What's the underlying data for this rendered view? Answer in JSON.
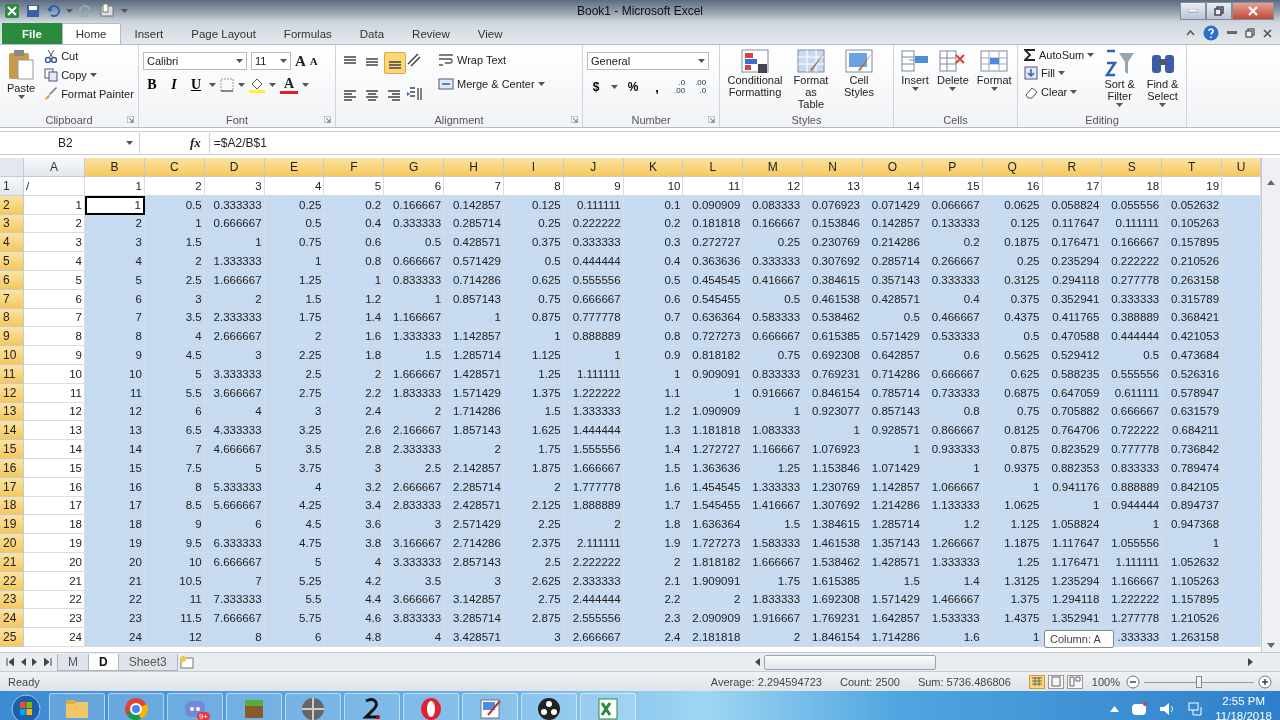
{
  "window": {
    "title": "Book1 - Microsoft Excel"
  },
  "ribbon_tabs": [
    {
      "label": "File",
      "kind": "file",
      "selected": false
    },
    {
      "label": "Home",
      "kind": "tab",
      "selected": true
    },
    {
      "label": "Insert",
      "kind": "tab",
      "selected": false
    },
    {
      "label": "Page Layout",
      "kind": "tab",
      "selected": false
    },
    {
      "label": "Formulas",
      "kind": "tab",
      "selected": false
    },
    {
      "label": "Data",
      "kind": "tab",
      "selected": false
    },
    {
      "label": "Review",
      "kind": "tab",
      "selected": false
    },
    {
      "label": "View",
      "kind": "tab",
      "selected": false
    }
  ],
  "clipboard": {
    "label": "Clipboard",
    "paste": "Paste",
    "cut": "Cut",
    "copy": "Copy",
    "format_painter": "Format Painter"
  },
  "font": {
    "label": "Font",
    "family": "Calibri",
    "size": "11",
    "grow": "A",
    "shrink": "A",
    "bold": "B",
    "italic": "I",
    "underline": "U",
    "font_color": "A"
  },
  "alignment": {
    "label": "Alignment",
    "wrap_text": "Wrap Text",
    "merge_center": "Merge & Center",
    "bottom_align_on": true
  },
  "number": {
    "label": "Number",
    "format": "General",
    "currency": "$",
    "percent": "%",
    "comma": ",",
    "increase_decimal": [
      ".0",
      ".00"
    ],
    "decrease_decimal": [
      ".00",
      ".0"
    ]
  },
  "styles": {
    "label": "Styles",
    "buttons": [
      "Conditional Formatting",
      "Format as Table",
      "Cell Styles"
    ]
  },
  "cells": {
    "label": "Cells",
    "buttons": [
      "Insert",
      "Delete",
      "Format"
    ]
  },
  "editing": {
    "label": "Editing",
    "autosum": "AutoSum",
    "fill": "Fill",
    "clear": "Clear",
    "sort_filter": "Sort & Filter",
    "find_select": "Find & Select"
  },
  "formula_bar": {
    "name_box": "B2",
    "fx": "fx",
    "formula": "=$A2/B$1"
  },
  "columns": [
    {
      "label": "A",
      "selected": false
    },
    {
      "label": "B",
      "selected": true
    },
    {
      "label": "C",
      "selected": true
    },
    {
      "label": "D",
      "selected": true
    },
    {
      "label": "E",
      "selected": true
    },
    {
      "label": "F",
      "selected": true
    },
    {
      "label": "G",
      "selected": true
    },
    {
      "label": "H",
      "selected": true
    },
    {
      "label": "I",
      "selected": true
    },
    {
      "label": "J",
      "selected": true
    },
    {
      "label": "K",
      "selected": true
    },
    {
      "label": "L",
      "selected": true
    },
    {
      "label": "M",
      "selected": true
    },
    {
      "label": "N",
      "selected": true
    },
    {
      "label": "O",
      "selected": true
    },
    {
      "label": "P",
      "selected": true
    },
    {
      "label": "Q",
      "selected": true
    },
    {
      "label": "R",
      "selected": true
    },
    {
      "label": "S",
      "selected": true
    },
    {
      "label": "T",
      "selected": true
    },
    {
      "label": "U",
      "selected": true
    }
  ],
  "rows": [
    {
      "header": "1",
      "selected": false,
      "cells": [
        {
          "text": "/",
          "kind": "text"
        },
        "1",
        "2",
        "3",
        "4",
        "5",
        "6",
        "7",
        "8",
        "9",
        "10",
        "11",
        "12",
        "13",
        "14",
        "15",
        "16",
        "17",
        "18",
        "19"
      ]
    },
    {
      "header": "2",
      "selected": true,
      "cells": [
        "1",
        {
          "text": "1",
          "active": true
        },
        "0.5",
        "0.333333",
        "0.25",
        "0.2",
        "0.166667",
        "0.142857",
        "0.125",
        "0.111111",
        "0.1",
        "0.090909",
        "0.083333",
        "0.076923",
        "0.071429",
        "0.066667",
        "0.0625",
        "0.058824",
        "0.055556",
        "0.052632"
      ]
    },
    {
      "header": "3",
      "selected": true,
      "cells": [
        "2",
        "2",
        "1",
        "0.666667",
        "0.5",
        "0.4",
        "0.333333",
        "0.285714",
        "0.25",
        "0.222222",
        "0.2",
        "0.181818",
        "0.166667",
        "0.153846",
        "0.142857",
        "0.133333",
        "0.125",
        "0.117647",
        "0.111111",
        "0.105263"
      ]
    },
    {
      "header": "4",
      "selected": true,
      "cells": [
        "3",
        "3",
        "1.5",
        "1",
        "0.75",
        "0.6",
        "0.5",
        "0.428571",
        "0.375",
        "0.333333",
        "0.3",
        "0.272727",
        "0.25",
        "0.230769",
        "0.214286",
        "0.2",
        "0.1875",
        "0.176471",
        "0.166667",
        "0.157895"
      ]
    },
    {
      "header": "5",
      "selected": true,
      "cells": [
        "4",
        "4",
        "2",
        "1.333333",
        "1",
        "0.8",
        "0.666667",
        "0.571429",
        "0.5",
        "0.444444",
        "0.4",
        "0.363636",
        "0.333333",
        "0.307692",
        "0.285714",
        "0.266667",
        "0.25",
        "0.235294",
        "0.222222",
        "0.210526"
      ]
    },
    {
      "header": "6",
      "selected": true,
      "cells": [
        "5",
        "5",
        "2.5",
        "1.666667",
        "1.25",
        "1",
        "0.833333",
        "0.714286",
        "0.625",
        "0.555556",
        "0.5",
        "0.454545",
        "0.416667",
        "0.384615",
        "0.357143",
        "0.333333",
        "0.3125",
        "0.294118",
        "0.277778",
        "0.263158"
      ]
    },
    {
      "header": "7",
      "selected": true,
      "cells": [
        "6",
        "6",
        "3",
        "2",
        "1.5",
        "1.2",
        "1",
        "0.857143",
        "0.75",
        "0.666667",
        "0.6",
        "0.545455",
        "0.5",
        "0.461538",
        "0.428571",
        "0.4",
        "0.375",
        "0.352941",
        "0.333333",
        "0.315789"
      ]
    },
    {
      "header": "8",
      "selected": true,
      "cells": [
        "7",
        "7",
        "3.5",
        "2.333333",
        "1.75",
        "1.4",
        "1.166667",
        "1",
        "0.875",
        "0.777778",
        "0.7",
        "0.636364",
        "0.583333",
        "0.538462",
        "0.5",
        "0.466667",
        "0.4375",
        "0.411765",
        "0.388889",
        "0.368421"
      ]
    },
    {
      "header": "9",
      "selected": true,
      "cells": [
        "8",
        "8",
        "4",
        "2.666667",
        "2",
        "1.6",
        "1.333333",
        "1.142857",
        "1",
        "0.888889",
        "0.8",
        "0.727273",
        "0.666667",
        "0.615385",
        "0.571429",
        "0.533333",
        "0.5",
        "0.470588",
        "0.444444",
        "0.421053"
      ]
    },
    {
      "header": "10",
      "selected": true,
      "cells": [
        "9",
        "9",
        "4.5",
        "3",
        "2.25",
        "1.8",
        "1.5",
        "1.285714",
        "1.125",
        "1",
        "0.9",
        "0.818182",
        "0.75",
        "0.692308",
        "0.642857",
        "0.6",
        "0.5625",
        "0.529412",
        "0.5",
        "0.473684"
      ]
    },
    {
      "header": "11",
      "selected": true,
      "cells": [
        "10",
        "10",
        "5",
        "3.333333",
        "2.5",
        "2",
        "1.666667",
        "1.428571",
        "1.25",
        "1.111111",
        "1",
        "0.909091",
        "0.833333",
        "0.769231",
        "0.714286",
        "0.666667",
        "0.625",
        "0.588235",
        "0.555556",
        "0.526316"
      ]
    },
    {
      "header": "12",
      "selected": true,
      "cells": [
        "11",
        "11",
        "5.5",
        "3.666667",
        "2.75",
        "2.2",
        "1.833333",
        "1.571429",
        "1.375",
        "1.222222",
        "1.1",
        "1",
        "0.916667",
        "0.846154",
        "0.785714",
        "0.733333",
        "0.6875",
        "0.647059",
        "0.611111",
        "0.578947"
      ]
    },
    {
      "header": "13",
      "selected": true,
      "cells": [
        "12",
        "12",
        "6",
        "4",
        "3",
        "2.4",
        "2",
        "1.714286",
        "1.5",
        "1.333333",
        "1.2",
        "1.090909",
        "1",
        "0.923077",
        "0.857143",
        "0.8",
        "0.75",
        "0.705882",
        "0.666667",
        "0.631579"
      ]
    },
    {
      "header": "14",
      "selected": true,
      "cells": [
        "13",
        "13",
        "6.5",
        "4.333333",
        "3.25",
        "2.6",
        "2.166667",
        "1.857143",
        "1.625",
        "1.444444",
        "1.3",
        "1.181818",
        "1.083333",
        "1",
        "0.928571",
        "0.866667",
        "0.8125",
        "0.764706",
        "0.722222",
        "0.684211"
      ]
    },
    {
      "header": "15",
      "selected": true,
      "cells": [
        "14",
        "14",
        "7",
        "4.666667",
        "3.5",
        "2.8",
        "2.333333",
        "2",
        "1.75",
        "1.555556",
        "1.4",
        "1.272727",
        "1.166667",
        "1.076923",
        "1",
        "0.933333",
        "0.875",
        "0.823529",
        "0.777778",
        "0.736842"
      ]
    },
    {
      "header": "16",
      "selected": true,
      "cells": [
        "15",
        "15",
        "7.5",
        "5",
        "3.75",
        "3",
        "2.5",
        "2.142857",
        "1.875",
        "1.666667",
        "1.5",
        "1.363636",
        "1.25",
        "1.153846",
        "1.071429",
        "1",
        "0.9375",
        "0.882353",
        "0.833333",
        "0.789474"
      ]
    },
    {
      "header": "17",
      "selected": true,
      "cells": [
        "16",
        "16",
        "8",
        "5.333333",
        "4",
        "3.2",
        "2.666667",
        "2.285714",
        "2",
        "1.777778",
        "1.6",
        "1.454545",
        "1.333333",
        "1.230769",
        "1.142857",
        "1.066667",
        "1",
        "0.941176",
        "0.888889",
        "0.842105"
      ]
    },
    {
      "header": "18",
      "selected": true,
      "cells": [
        "17",
        "17",
        "8.5",
        "5.666667",
        "4.25",
        "3.4",
        "2.833333",
        "2.428571",
        "2.125",
        "1.888889",
        "1.7",
        "1.545455",
        "1.416667",
        "1.307692",
        "1.214286",
        "1.133333",
        "1.0625",
        "1",
        "0.944444",
        "0.894737"
      ]
    },
    {
      "header": "19",
      "selected": true,
      "cells": [
        "18",
        "18",
        "9",
        "6",
        "4.5",
        "3.6",
        "3",
        "2.571429",
        "2.25",
        "2",
        "1.8",
        "1.636364",
        "1.5",
        "1.384615",
        "1.285714",
        "1.2",
        "1.125",
        "1.058824",
        "1",
        "0.947368"
      ]
    },
    {
      "header": "20",
      "selected": true,
      "cells": [
        "19",
        "19",
        "9.5",
        "6.333333",
        "4.75",
        "3.8",
        "3.166667",
        "2.714286",
        "2.375",
        "2.111111",
        "1.9",
        "1.727273",
        "1.583333",
        "1.461538",
        "1.357143",
        "1.266667",
        "1.1875",
        "1.117647",
        "1.055556",
        "1"
      ]
    },
    {
      "header": "21",
      "selected": true,
      "cells": [
        "20",
        "20",
        "10",
        "6.666667",
        "5",
        "4",
        "3.333333",
        "2.857143",
        "2.5",
        "2.222222",
        "2",
        "1.818182",
        "1.666667",
        "1.538462",
        "1.428571",
        "1.333333",
        "1.25",
        "1.176471",
        "1.111111",
        "1.052632"
      ]
    },
    {
      "header": "22",
      "selected": true,
      "cells": [
        "21",
        "21",
        "10.5",
        "7",
        "5.25",
        "4.2",
        "3.5",
        "3",
        "2.625",
        "2.333333",
        "2.1",
        "1.909091",
        "1.75",
        "1.615385",
        "1.5",
        "1.4",
        "1.3125",
        "1.235294",
        "1.166667",
        "1.105263"
      ]
    },
    {
      "header": "23",
      "selected": true,
      "cells": [
        "22",
        "22",
        "11",
        "7.333333",
        "5.5",
        "4.4",
        "3.666667",
        "3.142857",
        "2.75",
        "2.444444",
        "2.2",
        "2",
        "1.833333",
        "1.692308",
        "1.571429",
        "1.466667",
        "1.375",
        "1.294118",
        "1.222222",
        "1.157895"
      ]
    },
    {
      "header": "24",
      "selected": true,
      "cells": [
        "23",
        "23",
        "11.5",
        "7.666667",
        "5.75",
        "4.6",
        "3.833333",
        "3.285714",
        "2.875",
        "2.555556",
        "2.3",
        "2.090909",
        "1.916667",
        "1.769231",
        "1.642857",
        "1.533333",
        "1.4375",
        "1.352941",
        "1.277778",
        "1.210526"
      ]
    },
    {
      "header": "25",
      "selected": true,
      "cells": [
        "24",
        "24",
        "12",
        "8",
        "6",
        "4.8",
        "4",
        "3.428571",
        "3",
        "2.666667",
        "2.4",
        "2.181818",
        "2",
        "1.846154",
        "1.714286",
        "1.6",
        "1",
        null,
        ".333333",
        "1.263158"
      ]
    }
  ],
  "tooltip": "Column: A",
  "sheet_tabs": [
    {
      "label": "M",
      "selected": false
    },
    {
      "label": "D",
      "selected": true
    },
    {
      "label": "Sheet3",
      "selected": false
    }
  ],
  "status_bar": {
    "mode": "Ready",
    "average": "Average: 2.294594723",
    "count": "Count: 2500",
    "sum": "Sum: 5736.486806",
    "zoom": "100%",
    "zoom_level": {
      "level": 0.5
    },
    "views": [
      {
        "kind": "normal",
        "selected": true
      },
      {
        "kind": "page_layout",
        "selected": false
      },
      {
        "kind": "page_break",
        "selected": false
      }
    ]
  },
  "taskbar": {
    "chat_badge": "9+",
    "time": "2:55 PM",
    "date": "11/18/2018"
  }
}
